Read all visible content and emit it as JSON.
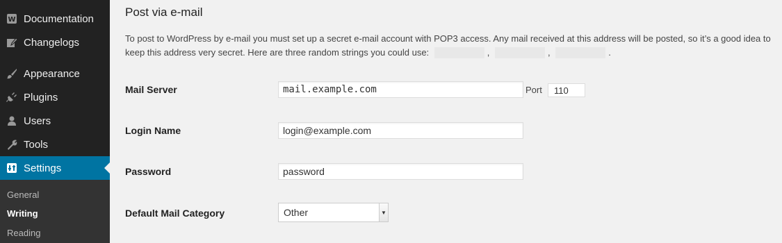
{
  "sidebar": {
    "items": [
      {
        "label": "Documentation",
        "icon": "documentation-icon"
      },
      {
        "label": "Changelogs",
        "icon": "edit-icon"
      },
      {
        "label": "Appearance",
        "icon": "paintbrush-icon"
      },
      {
        "label": "Plugins",
        "icon": "plugin-icon"
      },
      {
        "label": "Users",
        "icon": "users-icon"
      },
      {
        "label": "Tools",
        "icon": "wrench-icon"
      },
      {
        "label": "Settings",
        "icon": "settings-icon"
      }
    ],
    "submenu": [
      {
        "label": "General"
      },
      {
        "label": "Writing"
      },
      {
        "label": "Reading"
      }
    ],
    "active_color": "#0074a2"
  },
  "main": {
    "title": "Post via e-mail",
    "description_part1": "To post to WordPress by e-mail you must set up a secret e-mail account with POP3 access. Any mail received at this address will be posted, so it’s a good idea to keep this address very secret. Here are three random strings you could use:",
    "separator": ",",
    "end_punct": ".",
    "fields": {
      "mail_server": {
        "label": "Mail Server",
        "value": "mail.example.com"
      },
      "port": {
        "label": "Port",
        "value": "110"
      },
      "login_name": {
        "label": "Login Name",
        "value": "login@example.com"
      },
      "password": {
        "label": "Password",
        "value": "password"
      },
      "category": {
        "label": "Default Mail Category",
        "value": "Other"
      }
    }
  }
}
